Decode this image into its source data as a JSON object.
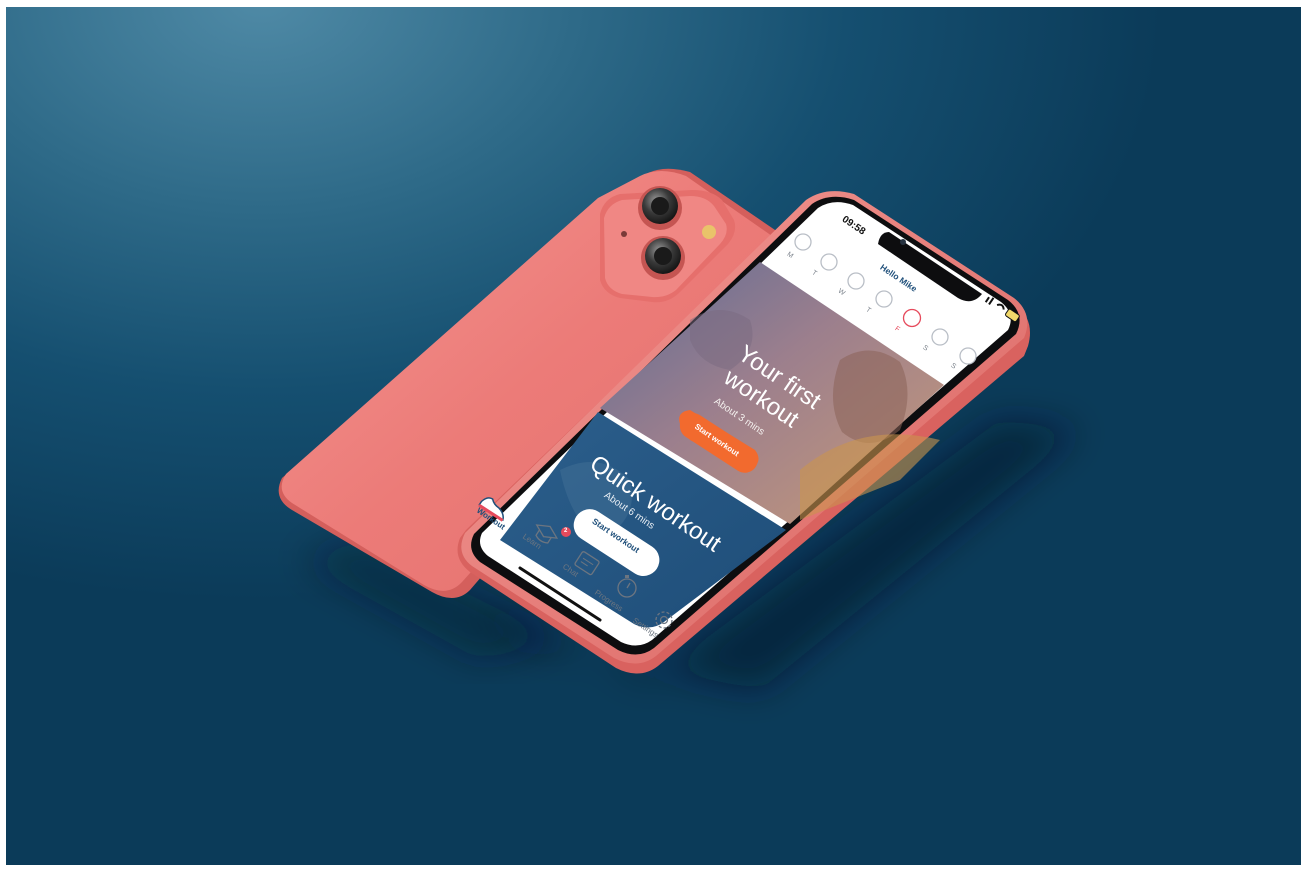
{
  "status_bar": {
    "time": "09:58"
  },
  "header": {
    "greeting": "Hello Mike"
  },
  "week": {
    "days": [
      "M",
      "T",
      "W",
      "T",
      "F",
      "S",
      "S"
    ],
    "active_index": 4,
    "active_color": "#e64a5c"
  },
  "first_workout": {
    "title_line1": "Your first",
    "title_line2": "workout",
    "duration": "About 3 mins",
    "button_label": "Start workout",
    "button_color": "#f26a2e"
  },
  "quick_workout": {
    "title": "Quick workout",
    "duration": "About 6 mins",
    "button_label": "Start workout"
  },
  "tab_bar": {
    "items": [
      {
        "label": "Workout",
        "icon": "sneaker-icon",
        "active": true
      },
      {
        "label": "Learn",
        "icon": "graduation-cap-icon",
        "badge": "2"
      },
      {
        "label": "Chat",
        "icon": "chat-bubble-icon"
      },
      {
        "label": "Progress",
        "icon": "stopwatch-icon"
      },
      {
        "label": "Settings",
        "icon": "gear-icon"
      }
    ]
  },
  "colors": {
    "phone_body": "#ee7b78",
    "background": "#154f70",
    "brand_blue": "#1f4f7a"
  }
}
